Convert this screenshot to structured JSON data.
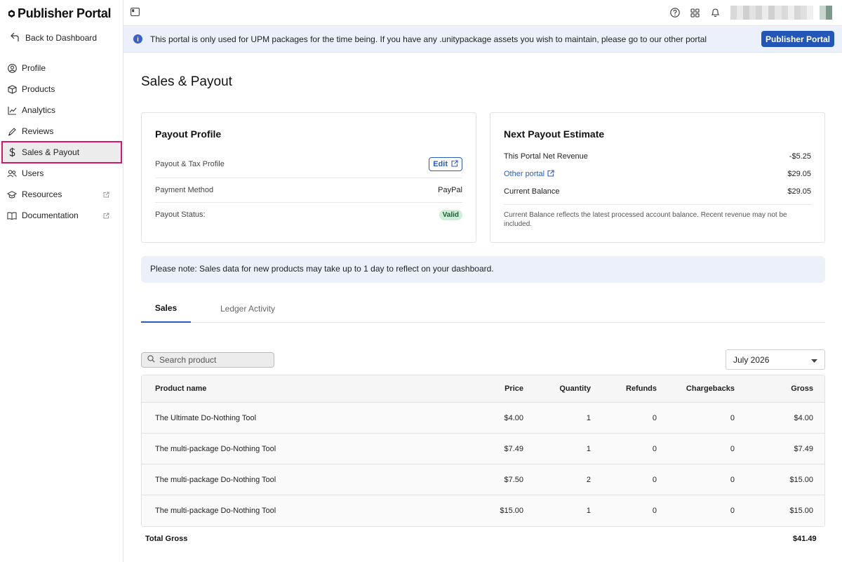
{
  "app": {
    "title": "Publisher Portal",
    "back_label": "Back to Dashboard"
  },
  "sidebar": {
    "items": [
      {
        "label": "Profile",
        "icon": "user-circle-icon"
      },
      {
        "label": "Products",
        "icon": "box-icon"
      },
      {
        "label": "Analytics",
        "icon": "chart-line-icon"
      },
      {
        "label": "Reviews",
        "icon": "pen-icon"
      },
      {
        "label": "Sales & Payout",
        "icon": "dollar-icon"
      },
      {
        "label": "Users",
        "icon": "users-icon"
      },
      {
        "label": "Resources",
        "icon": "graduation-cap-icon"
      },
      {
        "label": "Documentation",
        "icon": "book-icon"
      }
    ],
    "active_index": 4
  },
  "banner": {
    "text": "This portal is only used for UPM packages for the time being. If you have any .unitypackage assets you wish to maintain, please go to our other portal",
    "button_label": "Publisher Portal",
    "info_glyph": "i"
  },
  "main": {
    "title": "Sales & Payout"
  },
  "payout_profile": {
    "title": "Payout Profile",
    "tax_profile_label": "Payout & Tax Profile",
    "edit_label": "Edit",
    "payment_method_label": "Payment Method",
    "payment_method_value": "PayPal",
    "status_label": "Payout Status:",
    "status_value": "Valid"
  },
  "estimate": {
    "title": "Next Payout Estimate",
    "net_revenue_label": "This Portal Net Revenue",
    "net_revenue_value": "-$5.25",
    "other_portal_label": "Other portal",
    "other_portal_value": "$29.05",
    "balance_label": "Current Balance",
    "balance_value": "$29.05",
    "note": "Current Balance reflects the latest processed account balance. Recent revenue may not be included."
  },
  "notice": {
    "text": "Please note: Sales data for new products may take up to 1 day to reflect on your dashboard."
  },
  "tabs": {
    "sales": "Sales",
    "ledger": "Ledger Activity"
  },
  "search": {
    "placeholder": "Search product"
  },
  "month_select": {
    "value": "July 2026"
  },
  "table": {
    "headers": {
      "name": "Product name",
      "price": "Price",
      "quantity": "Quantity",
      "refunds": "Refunds",
      "chargebacks": "Chargebacks",
      "gross": "Gross"
    },
    "rows": [
      {
        "name": "The Ultimate Do-Nothing Tool",
        "price": "$4.00",
        "quantity": "1",
        "refunds": "0",
        "chargebacks": "0",
        "gross": "$4.00"
      },
      {
        "name": "The multi-package Do-Nothing Tool",
        "price": "$7.49",
        "quantity": "1",
        "refunds": "0",
        "chargebacks": "0",
        "gross": "$7.49"
      },
      {
        "name": "The multi-package Do-Nothing Tool",
        "price": "$7.50",
        "quantity": "2",
        "refunds": "0",
        "chargebacks": "0",
        "gross": "$15.00"
      },
      {
        "name": "The multi-package Do-Nothing Tool",
        "price": "$15.00",
        "quantity": "1",
        "refunds": "0",
        "chargebacks": "0",
        "gross": "$15.00"
      }
    ],
    "total_label": "Total Gross",
    "total_value": "$41.49"
  },
  "colors": {
    "accent": "#2a5bbf",
    "active_outline": "#d6156c",
    "banner_bg": "#ebf0fb",
    "valid_bg": "#cfeed8"
  }
}
